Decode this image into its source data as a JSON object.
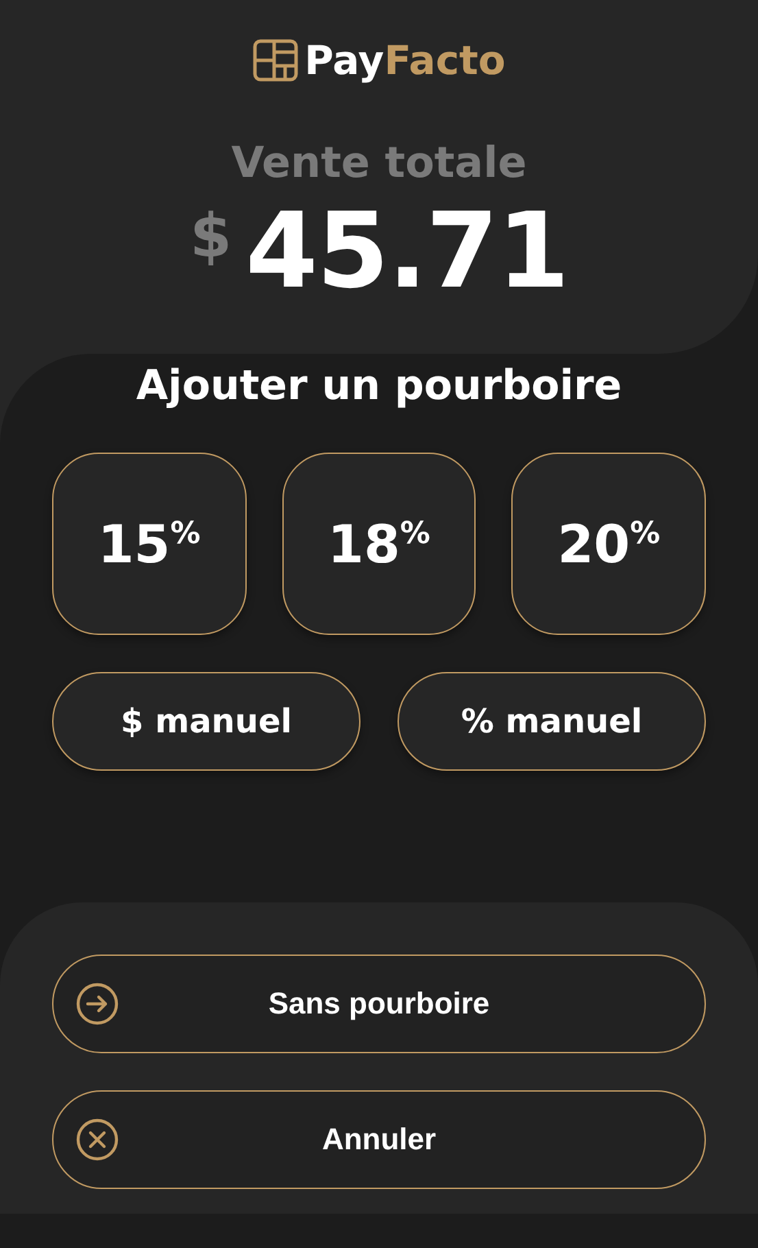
{
  "logo": {
    "part_1": "Pay",
    "part_2": "Facto"
  },
  "total": {
    "label": "Vente totale",
    "currency": "$",
    "amount": "45.71"
  },
  "tip": {
    "title": "Ajouter un pourboire",
    "presets": [
      {
        "label": "15$^{%}$"
      },
      {
        "label": "18$^{%}$"
      },
      {
        "label": "20$^{%}$"
      }
    ],
    "manual": [
      "$ manuel",
      "% manuel"
    ]
  },
  "actions": [
    {
      "kind": "proceed",
      "label": "Sans pourboire"
    },
    {
      "kind": "cancel",
      "label": "Annuler"
    }
  ]
}
